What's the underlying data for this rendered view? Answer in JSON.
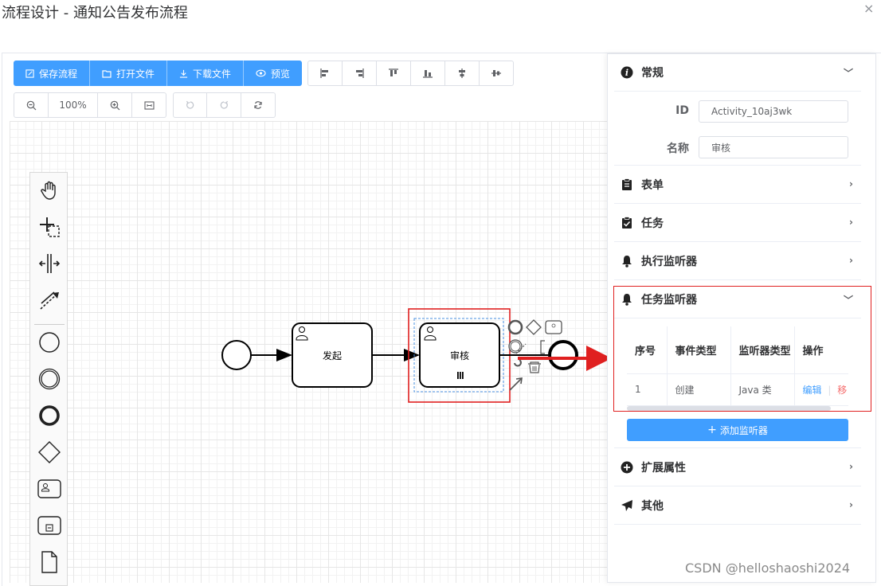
{
  "dialog": {
    "title": "流程设计 - 通知公告发布流程",
    "close": "×"
  },
  "toolbar": {
    "save": "保存流程",
    "open": "打开文件",
    "download": "下载文件",
    "preview": "预览",
    "zoom": "100%"
  },
  "diagram": {
    "task1_name": "发起",
    "task2_name": "审核"
  },
  "panel": {
    "general": {
      "title": "常规",
      "id_label": "ID",
      "id_value": "Activity_10aj3wk",
      "name_label": "名称",
      "name_value": "审核"
    },
    "form": {
      "title": "表单"
    },
    "task": {
      "title": "任务"
    },
    "exec_listener": {
      "title": "执行监听器"
    },
    "task_listener": {
      "title": "任务监听器",
      "columns": [
        "序号",
        "事件类型",
        "监听器类型",
        "操作"
      ],
      "rows": [
        {
          "index": "1",
          "event": "创建",
          "type": "Java 类",
          "edit": "编辑",
          "remove": "移"
        }
      ],
      "add_button": "添加监听器"
    },
    "ext": {
      "title": "扩展属性"
    },
    "other": {
      "title": "其他"
    }
  },
  "accent": "#409eff",
  "highlight": "#e02020",
  "watermark": "CSDN @helloshaoshi2024"
}
